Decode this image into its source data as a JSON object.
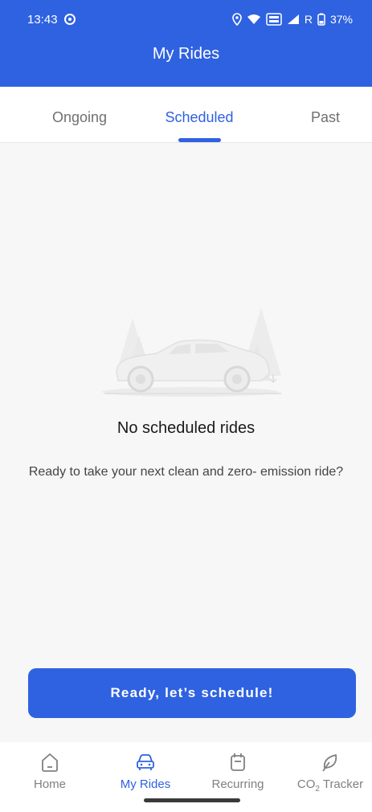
{
  "status_bar": {
    "time": "13:43",
    "battery": "37%",
    "carrier_flag": "R",
    "icons": [
      "pinterest-icon",
      "location-icon",
      "wifi-icon",
      "volte-icon",
      "signal-icon",
      "battery-icon"
    ]
  },
  "header": {
    "title": "My Rides"
  },
  "tabs": [
    {
      "label": "Ongoing"
    },
    {
      "label": "Scheduled"
    },
    {
      "label": "Past"
    }
  ],
  "active_tab": "Scheduled",
  "empty_state": {
    "illustration": "car-with-trees-illustration",
    "title": "No scheduled rides",
    "description": "Ready to take your next clean and zero- emission ride?"
  },
  "cta": {
    "label": "Ready, let’s schedule!"
  },
  "bottom_nav": {
    "items": [
      {
        "label": "Home",
        "icon": "home-icon"
      },
      {
        "label": "My Rides",
        "icon": "car-icon"
      },
      {
        "label": "Recurring",
        "icon": "calendar-icon"
      },
      {
        "label_prefix": "CO",
        "label_sub": "2",
        "label_suffix": " Tracker",
        "icon": "leaf-icon"
      }
    ],
    "active": "My Rides"
  },
  "colors": {
    "primary": "#2f62e0",
    "background": "#f7f7f7",
    "inactive": "#808080"
  }
}
